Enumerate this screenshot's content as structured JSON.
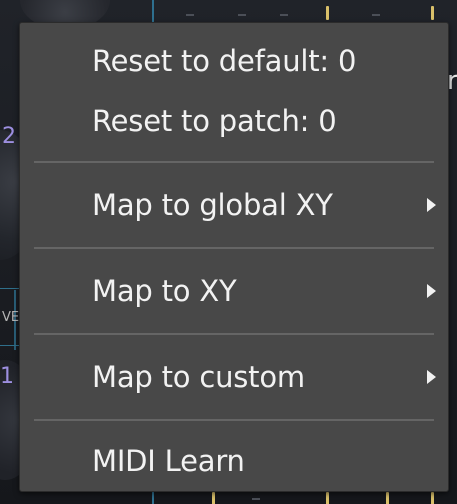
{
  "background": {
    "fragments": {
      "num_top": "2",
      "num_bottom": "1",
      "ve_text": "VE",
      "right_letter": "r"
    }
  },
  "context_menu": {
    "items": [
      {
        "label": "Reset to default: 0",
        "has_submenu": false
      },
      {
        "label": "Reset to patch: 0",
        "has_submenu": false
      },
      {
        "label": "Map to global XY",
        "has_submenu": true
      },
      {
        "label": "Map to XY",
        "has_submenu": true
      },
      {
        "label": "Map to custom",
        "has_submenu": true
      },
      {
        "label": "MIDI Learn",
        "has_submenu": false
      }
    ],
    "submenu_icon": "chevron-right-icon",
    "colors": {
      "menu_background": "#484848",
      "text": "#f2f2f2",
      "separator": "#656565",
      "accent_blue": "#2e6f8e",
      "accent_gold": "#d9c06a",
      "accent_purple": "#9d8fe0"
    }
  }
}
